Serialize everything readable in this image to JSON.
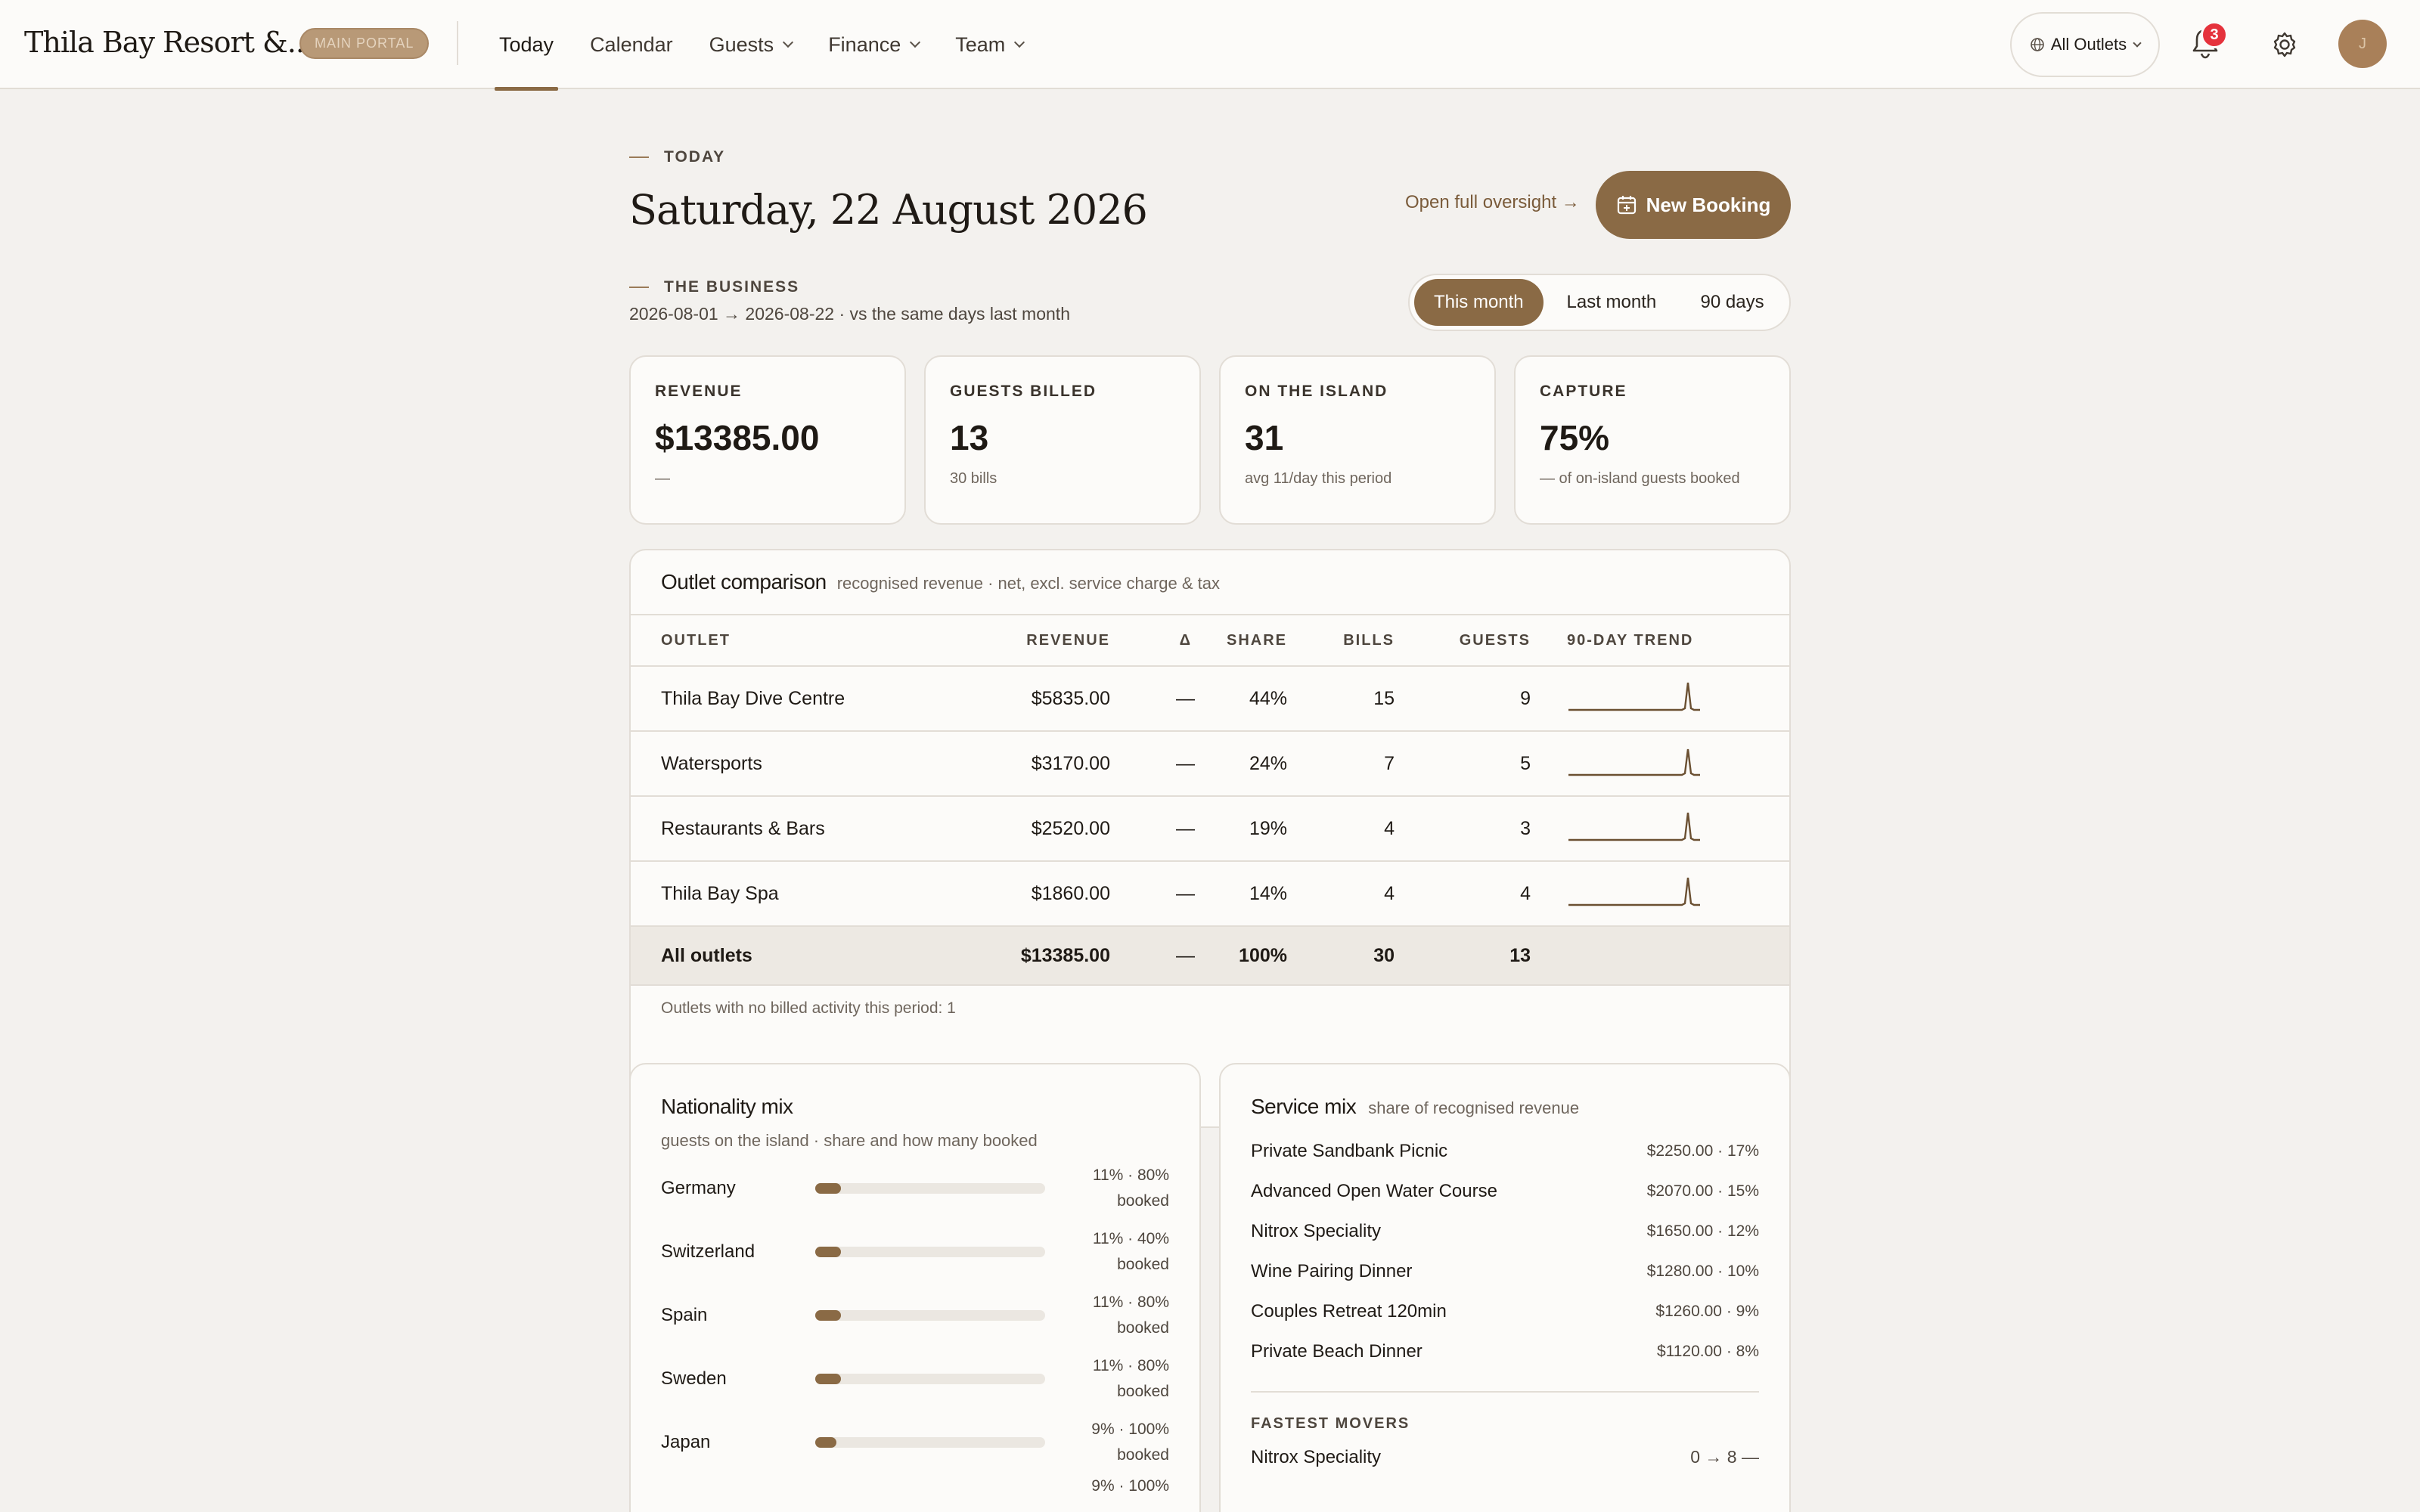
{
  "nav": {
    "brand": "Thila Bay Resort &...",
    "portal_badge": "MAIN PORTAL",
    "links": [
      {
        "label": "Today",
        "active": true,
        "dropdown": false
      },
      {
        "label": "Calendar",
        "active": false,
        "dropdown": false
      },
      {
        "label": "Guests",
        "active": false,
        "dropdown": true
      },
      {
        "label": "Finance",
        "active": false,
        "dropdown": true
      },
      {
        "label": "Team",
        "active": false,
        "dropdown": true
      }
    ],
    "outlet_selector": "All Outlets",
    "notification_count": "3",
    "avatar_initial": "J"
  },
  "header": {
    "kicker": "TODAY",
    "date": "Saturday, 22 August 2026",
    "oversight_link": "Open full oversight →",
    "new_booking": "New Booking"
  },
  "business": {
    "kicker": "THE BUSINESS",
    "range": "2026-08-01 → 2026-08-22 · vs the same days last month",
    "periods": [
      "This month",
      "Last month",
      "90 days"
    ],
    "active_period": "This month"
  },
  "kpis": [
    {
      "label": "REVENUE",
      "value": "$13385.00",
      "sub": "—"
    },
    {
      "label": "GUESTS BILLED",
      "value": "13",
      "sub": "30 bills"
    },
    {
      "label": "ON THE ISLAND",
      "value": "31",
      "sub": "avg 11/day this period"
    },
    {
      "label": "CAPTURE",
      "value": "75%",
      "sub": "— of on-island guests booked"
    }
  ],
  "outlets": {
    "title": "Outlet comparison",
    "subtitle": "recognised revenue · net, excl. service charge & tax",
    "columns": [
      "OUTLET",
      "REVENUE",
      "Δ",
      "SHARE",
      "BILLS",
      "GUESTS",
      "90-DAY TREND"
    ],
    "rows": [
      {
        "name": "Thila Bay Dive Centre",
        "revenue": "$5835.00",
        "delta": "—",
        "share": "44%",
        "bills": "15",
        "guests": "9"
      },
      {
        "name": "Watersports",
        "revenue": "$3170.00",
        "delta": "—",
        "share": "24%",
        "bills": "7",
        "guests": "5"
      },
      {
        "name": "Restaurants & Bars",
        "revenue": "$2520.00",
        "delta": "—",
        "share": "19%",
        "bills": "4",
        "guests": "3"
      },
      {
        "name": "Thila Bay Spa",
        "revenue": "$1860.00",
        "delta": "—",
        "share": "14%",
        "bills": "4",
        "guests": "4"
      }
    ],
    "total": {
      "name": "All outlets",
      "revenue": "$13385.00",
      "delta": "—",
      "share": "100%",
      "bills": "30",
      "guests": "13"
    },
    "footnote": "Outlets with no billed activity this period: 1"
  },
  "nationality": {
    "title": "Nationality mix",
    "subtitle": "guests on the island · share and how many booked",
    "rows": [
      {
        "country": "Germany",
        "share": 0.11,
        "line1": "11% · 80%",
        "line2": "booked"
      },
      {
        "country": "Switzerland",
        "share": 0.11,
        "line1": "11% · 40%",
        "line2": "booked"
      },
      {
        "country": "Spain",
        "share": 0.11,
        "line1": "11% · 80%",
        "line2": "booked"
      },
      {
        "country": "Sweden",
        "share": 0.11,
        "line1": "11% · 80%",
        "line2": "booked"
      },
      {
        "country": "Japan",
        "share": 0.09,
        "line1": "9% · 100%",
        "line2": "booked"
      }
    ],
    "partial_row": "9% · 100%"
  },
  "service": {
    "title": "Service mix",
    "subtitle": "share of recognised revenue",
    "items": [
      {
        "name": "Private Sandbank Picnic",
        "value": "$2250.00 · 17%"
      },
      {
        "name": "Advanced Open Water Course",
        "value": "$2070.00 · 15%"
      },
      {
        "name": "Nitrox Speciality",
        "value": "$1650.00 · 12%"
      },
      {
        "name": "Wine Pairing Dinner",
        "value": "$1280.00 · 10%"
      },
      {
        "name": "Couples Retreat 120min",
        "value": "$1260.00 · 9%"
      },
      {
        "name": "Private Beach Dinner",
        "value": "$1120.00 · 8%"
      }
    ],
    "movers_title": "FASTEST MOVERS",
    "movers": [
      {
        "name": "Nitrox Speciality",
        "value": "0 → 8 —"
      }
    ]
  },
  "colors": {
    "accent": "#8a6a45",
    "badge": "#e5323c",
    "background": "#f3f1ee",
    "card": "#fcfbf9"
  }
}
